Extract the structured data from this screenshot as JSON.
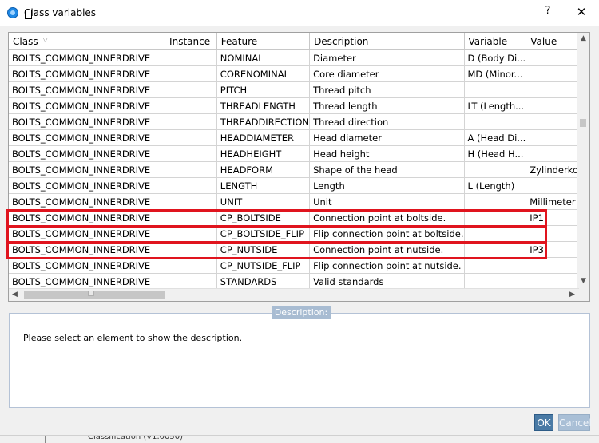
{
  "window": {
    "title": "Class variables",
    "help_label": "?",
    "close_label": "✕"
  },
  "grid": {
    "columns": [
      "Class",
      "Instance",
      "Feature",
      "Description",
      "Variable",
      "Value"
    ],
    "rows": [
      {
        "class": "BOLTS_COMMON_INNERDRIVE",
        "instance": "",
        "feature": "NOMINAL",
        "description": "Diameter",
        "variable": "D (Body Di...",
        "value": ""
      },
      {
        "class": "BOLTS_COMMON_INNERDRIVE",
        "instance": "",
        "feature": "CORENOMINAL",
        "description": "Core diameter",
        "variable": "MD (Minor...",
        "value": ""
      },
      {
        "class": "BOLTS_COMMON_INNERDRIVE",
        "instance": "",
        "feature": "PITCH",
        "description": "Thread pitch",
        "variable": "",
        "value": ""
      },
      {
        "class": "BOLTS_COMMON_INNERDRIVE",
        "instance": "",
        "feature": "THREADLENGTH",
        "description": "Thread length",
        "variable": "LT (Length...",
        "value": ""
      },
      {
        "class": "BOLTS_COMMON_INNERDRIVE",
        "instance": "",
        "feature": "THREADDIRECTION",
        "description": "Thread direction",
        "variable": "",
        "value": ""
      },
      {
        "class": "BOLTS_COMMON_INNERDRIVE",
        "instance": "",
        "feature": "HEADDIAMETER",
        "description": "Head diameter",
        "variable": "A (Head Di...",
        "value": ""
      },
      {
        "class": "BOLTS_COMMON_INNERDRIVE",
        "instance": "",
        "feature": "HEADHEIGHT",
        "description": "Head height",
        "variable": "H (Head H...",
        "value": ""
      },
      {
        "class": "BOLTS_COMMON_INNERDRIVE",
        "instance": "",
        "feature": "HEADFORM",
        "description": "Shape of the head",
        "variable": "",
        "value": "Zylinderkopf"
      },
      {
        "class": "BOLTS_COMMON_INNERDRIVE",
        "instance": "",
        "feature": "LENGTH",
        "description": "Length",
        "variable": "L (Length)",
        "value": ""
      },
      {
        "class": "BOLTS_COMMON_INNERDRIVE",
        "instance": "",
        "feature": "UNIT",
        "description": "Unit",
        "variable": "",
        "value": "Millimeter"
      },
      {
        "class": "BOLTS_COMMON_INNERDRIVE",
        "instance": "",
        "feature": "CP_BOLTSIDE",
        "description": "Connection point at boltside.",
        "variable": "",
        "value": "IP1"
      },
      {
        "class": "BOLTS_COMMON_INNERDRIVE",
        "instance": "",
        "feature": "CP_BOLTSIDE_FLIP",
        "description": "Flip connection point at boltside.",
        "variable": "",
        "value": ""
      },
      {
        "class": "BOLTS_COMMON_INNERDRIVE",
        "instance": "",
        "feature": "CP_NUTSIDE",
        "description": "Connection point at nutside.",
        "variable": "",
        "value": "IP3"
      },
      {
        "class": "BOLTS_COMMON_INNERDRIVE",
        "instance": "",
        "feature": "CP_NUTSIDE_FLIP",
        "description": "Flip connection point at nutside.",
        "variable": "",
        "value": ""
      },
      {
        "class": "BOLTS_COMMON_INNERDRIVE",
        "instance": "",
        "feature": "STANDARDS",
        "description": "Valid standards",
        "variable": "",
        "value": ""
      }
    ]
  },
  "description_panel": {
    "title": "Description:",
    "text": "Please select an element to show the description."
  },
  "buttons": {
    "ok": "OK",
    "cancel": "Cancel"
  },
  "background_text": "Classification (V1.0050)",
  "colors": {
    "highlight": "#e0141e",
    "ok_button": "#4a7aa5",
    "panel_title": "#a8bcd2"
  }
}
